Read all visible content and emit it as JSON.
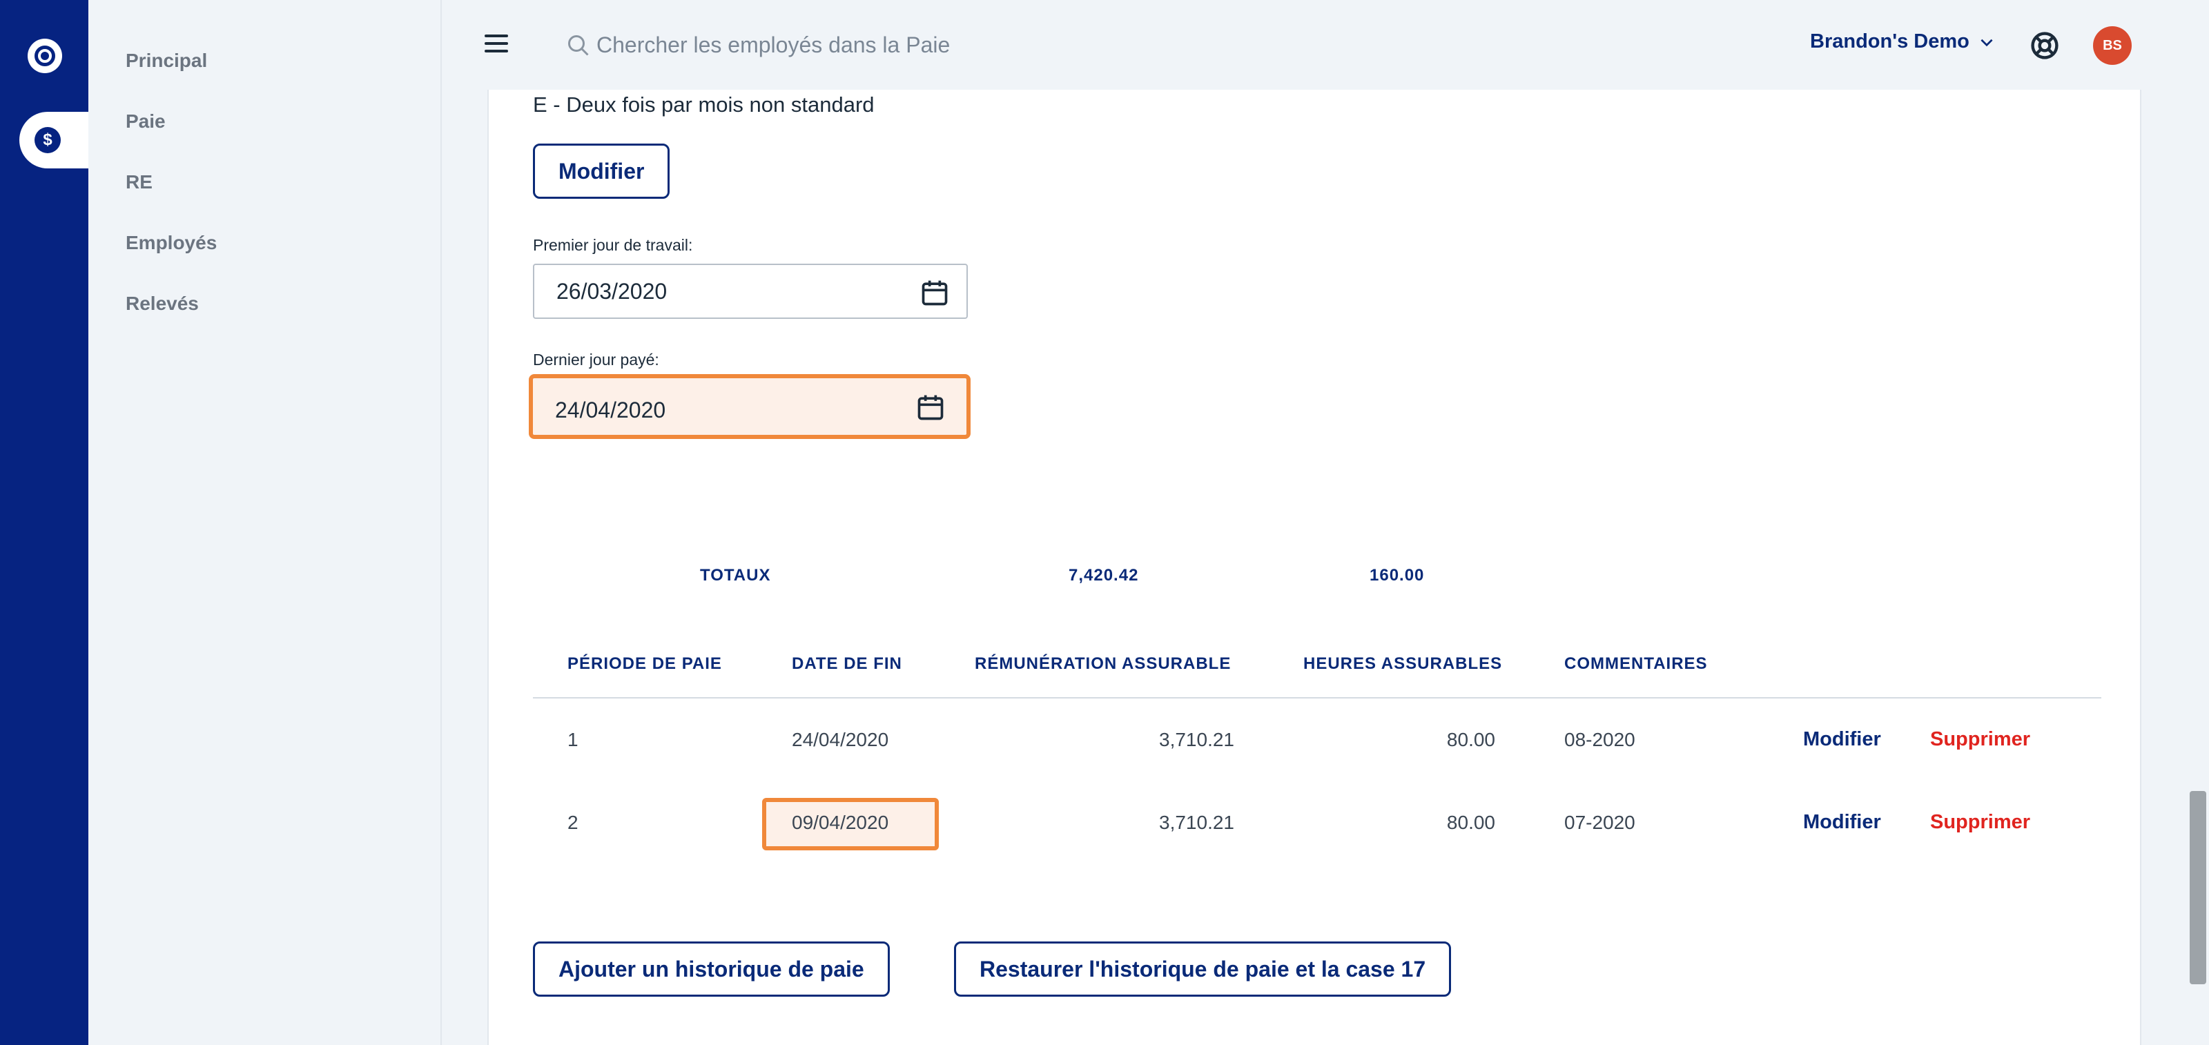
{
  "sidebar": {
    "items": [
      {
        "label": "Principal"
      },
      {
        "label": "Paie"
      },
      {
        "label": "RE"
      },
      {
        "label": "Employés"
      },
      {
        "label": "Relevés"
      }
    ]
  },
  "header": {
    "search_placeholder": "Chercher les employés dans la Paie",
    "account_name": "Brandon's Demo",
    "avatar_initials": "BS"
  },
  "form": {
    "pay_frequency": "E - Deux fois par mois non standard",
    "modify_button": "Modifier",
    "first_day_label": "Premier jour de travail:",
    "first_day_value": "26/03/2020",
    "last_day_label": "Dernier jour payé:",
    "last_day_value": "24/04/2020"
  },
  "totals": {
    "label": "TOTAUX",
    "insurable_earnings": "7,420.42",
    "insurable_hours": "160.00"
  },
  "table": {
    "headers": [
      "PÉRIODE DE PAIE",
      "DATE DE FIN",
      "RÉMUNÉRATION ASSURABLE",
      "HEURES ASSURABLES",
      "COMMENTAIRES"
    ],
    "rows": [
      {
        "period": "1",
        "end_date": "24/04/2020",
        "earnings": "3,710.21",
        "hours": "80.00",
        "comment": "08-2020",
        "edit": "Modifier",
        "delete": "Supprimer"
      },
      {
        "period": "2",
        "end_date": "09/04/2020",
        "earnings": "3,710.21",
        "hours": "80.00",
        "comment": "07-2020",
        "edit": "Modifier",
        "delete": "Supprimer"
      }
    ]
  },
  "actions": {
    "add_history": "Ajouter un historique de paie",
    "restore_history": "Restaurer l'historique de paie et la case 17"
  },
  "colors": {
    "brand_navy": "#062381",
    "highlight_orange": "#f0883a",
    "delete_red": "#e0241f"
  }
}
